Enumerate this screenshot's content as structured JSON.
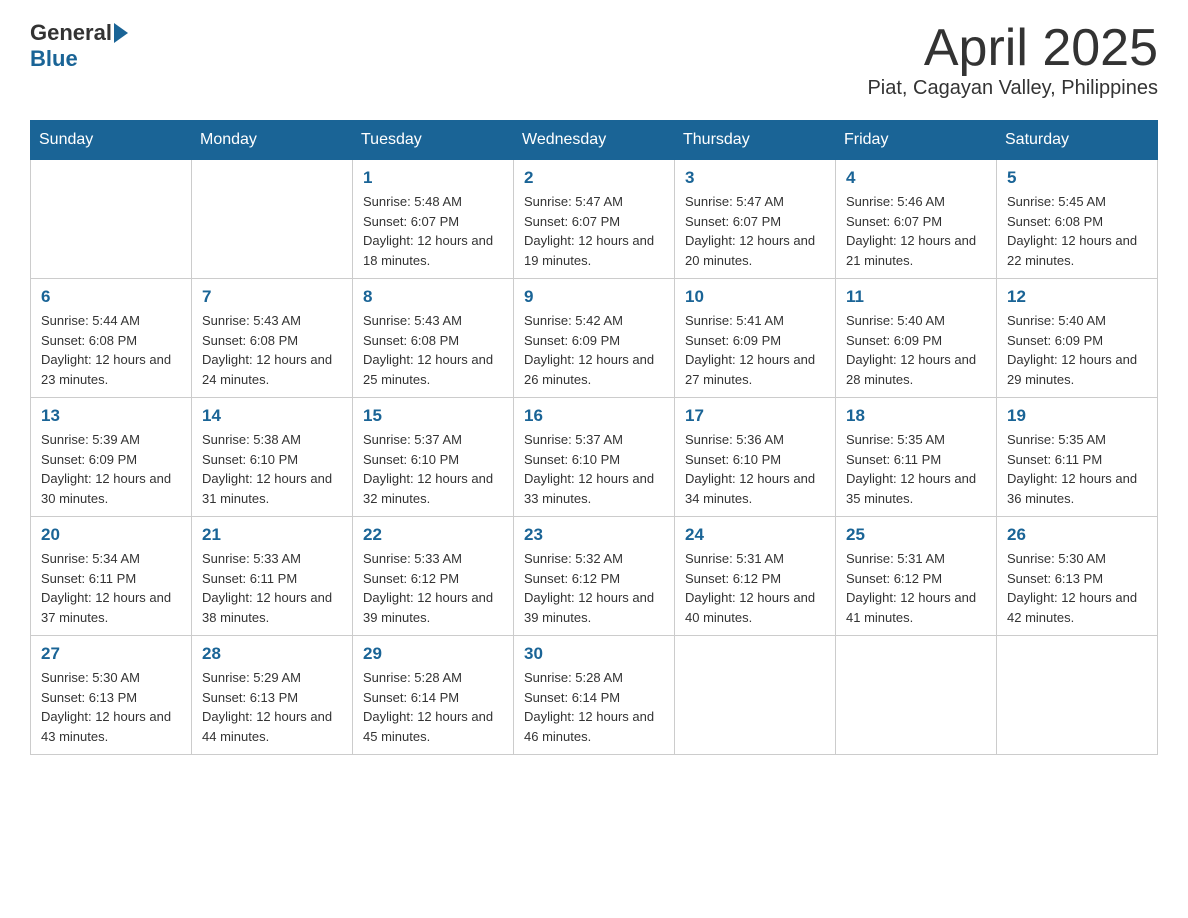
{
  "header": {
    "logo_general": "General",
    "logo_blue": "Blue",
    "title": "April 2025",
    "subtitle": "Piat, Cagayan Valley, Philippines"
  },
  "weekdays": [
    "Sunday",
    "Monday",
    "Tuesday",
    "Wednesday",
    "Thursday",
    "Friday",
    "Saturday"
  ],
  "weeks": [
    [
      {
        "day": "",
        "sunrise": "",
        "sunset": "",
        "daylight": ""
      },
      {
        "day": "",
        "sunrise": "",
        "sunset": "",
        "daylight": ""
      },
      {
        "day": "1",
        "sunrise": "Sunrise: 5:48 AM",
        "sunset": "Sunset: 6:07 PM",
        "daylight": "Daylight: 12 hours and 18 minutes."
      },
      {
        "day": "2",
        "sunrise": "Sunrise: 5:47 AM",
        "sunset": "Sunset: 6:07 PM",
        "daylight": "Daylight: 12 hours and 19 minutes."
      },
      {
        "day": "3",
        "sunrise": "Sunrise: 5:47 AM",
        "sunset": "Sunset: 6:07 PM",
        "daylight": "Daylight: 12 hours and 20 minutes."
      },
      {
        "day": "4",
        "sunrise": "Sunrise: 5:46 AM",
        "sunset": "Sunset: 6:07 PM",
        "daylight": "Daylight: 12 hours and 21 minutes."
      },
      {
        "day": "5",
        "sunrise": "Sunrise: 5:45 AM",
        "sunset": "Sunset: 6:08 PM",
        "daylight": "Daylight: 12 hours and 22 minutes."
      }
    ],
    [
      {
        "day": "6",
        "sunrise": "Sunrise: 5:44 AM",
        "sunset": "Sunset: 6:08 PM",
        "daylight": "Daylight: 12 hours and 23 minutes."
      },
      {
        "day": "7",
        "sunrise": "Sunrise: 5:43 AM",
        "sunset": "Sunset: 6:08 PM",
        "daylight": "Daylight: 12 hours and 24 minutes."
      },
      {
        "day": "8",
        "sunrise": "Sunrise: 5:43 AM",
        "sunset": "Sunset: 6:08 PM",
        "daylight": "Daylight: 12 hours and 25 minutes."
      },
      {
        "day": "9",
        "sunrise": "Sunrise: 5:42 AM",
        "sunset": "Sunset: 6:09 PM",
        "daylight": "Daylight: 12 hours and 26 minutes."
      },
      {
        "day": "10",
        "sunrise": "Sunrise: 5:41 AM",
        "sunset": "Sunset: 6:09 PM",
        "daylight": "Daylight: 12 hours and 27 minutes."
      },
      {
        "day": "11",
        "sunrise": "Sunrise: 5:40 AM",
        "sunset": "Sunset: 6:09 PM",
        "daylight": "Daylight: 12 hours and 28 minutes."
      },
      {
        "day": "12",
        "sunrise": "Sunrise: 5:40 AM",
        "sunset": "Sunset: 6:09 PM",
        "daylight": "Daylight: 12 hours and 29 minutes."
      }
    ],
    [
      {
        "day": "13",
        "sunrise": "Sunrise: 5:39 AM",
        "sunset": "Sunset: 6:09 PM",
        "daylight": "Daylight: 12 hours and 30 minutes."
      },
      {
        "day": "14",
        "sunrise": "Sunrise: 5:38 AM",
        "sunset": "Sunset: 6:10 PM",
        "daylight": "Daylight: 12 hours and 31 minutes."
      },
      {
        "day": "15",
        "sunrise": "Sunrise: 5:37 AM",
        "sunset": "Sunset: 6:10 PM",
        "daylight": "Daylight: 12 hours and 32 minutes."
      },
      {
        "day": "16",
        "sunrise": "Sunrise: 5:37 AM",
        "sunset": "Sunset: 6:10 PM",
        "daylight": "Daylight: 12 hours and 33 minutes."
      },
      {
        "day": "17",
        "sunrise": "Sunrise: 5:36 AM",
        "sunset": "Sunset: 6:10 PM",
        "daylight": "Daylight: 12 hours and 34 minutes."
      },
      {
        "day": "18",
        "sunrise": "Sunrise: 5:35 AM",
        "sunset": "Sunset: 6:11 PM",
        "daylight": "Daylight: 12 hours and 35 minutes."
      },
      {
        "day": "19",
        "sunrise": "Sunrise: 5:35 AM",
        "sunset": "Sunset: 6:11 PM",
        "daylight": "Daylight: 12 hours and 36 minutes."
      }
    ],
    [
      {
        "day": "20",
        "sunrise": "Sunrise: 5:34 AM",
        "sunset": "Sunset: 6:11 PM",
        "daylight": "Daylight: 12 hours and 37 minutes."
      },
      {
        "day": "21",
        "sunrise": "Sunrise: 5:33 AM",
        "sunset": "Sunset: 6:11 PM",
        "daylight": "Daylight: 12 hours and 38 minutes."
      },
      {
        "day": "22",
        "sunrise": "Sunrise: 5:33 AM",
        "sunset": "Sunset: 6:12 PM",
        "daylight": "Daylight: 12 hours and 39 minutes."
      },
      {
        "day": "23",
        "sunrise": "Sunrise: 5:32 AM",
        "sunset": "Sunset: 6:12 PM",
        "daylight": "Daylight: 12 hours and 39 minutes."
      },
      {
        "day": "24",
        "sunrise": "Sunrise: 5:31 AM",
        "sunset": "Sunset: 6:12 PM",
        "daylight": "Daylight: 12 hours and 40 minutes."
      },
      {
        "day": "25",
        "sunrise": "Sunrise: 5:31 AM",
        "sunset": "Sunset: 6:12 PM",
        "daylight": "Daylight: 12 hours and 41 minutes."
      },
      {
        "day": "26",
        "sunrise": "Sunrise: 5:30 AM",
        "sunset": "Sunset: 6:13 PM",
        "daylight": "Daylight: 12 hours and 42 minutes."
      }
    ],
    [
      {
        "day": "27",
        "sunrise": "Sunrise: 5:30 AM",
        "sunset": "Sunset: 6:13 PM",
        "daylight": "Daylight: 12 hours and 43 minutes."
      },
      {
        "day": "28",
        "sunrise": "Sunrise: 5:29 AM",
        "sunset": "Sunset: 6:13 PM",
        "daylight": "Daylight: 12 hours and 44 minutes."
      },
      {
        "day": "29",
        "sunrise": "Sunrise: 5:28 AM",
        "sunset": "Sunset: 6:14 PM",
        "daylight": "Daylight: 12 hours and 45 minutes."
      },
      {
        "day": "30",
        "sunrise": "Sunrise: 5:28 AM",
        "sunset": "Sunset: 6:14 PM",
        "daylight": "Daylight: 12 hours and 46 minutes."
      },
      {
        "day": "",
        "sunrise": "",
        "sunset": "",
        "daylight": ""
      },
      {
        "day": "",
        "sunrise": "",
        "sunset": "",
        "daylight": ""
      },
      {
        "day": "",
        "sunrise": "",
        "sunset": "",
        "daylight": ""
      }
    ]
  ]
}
